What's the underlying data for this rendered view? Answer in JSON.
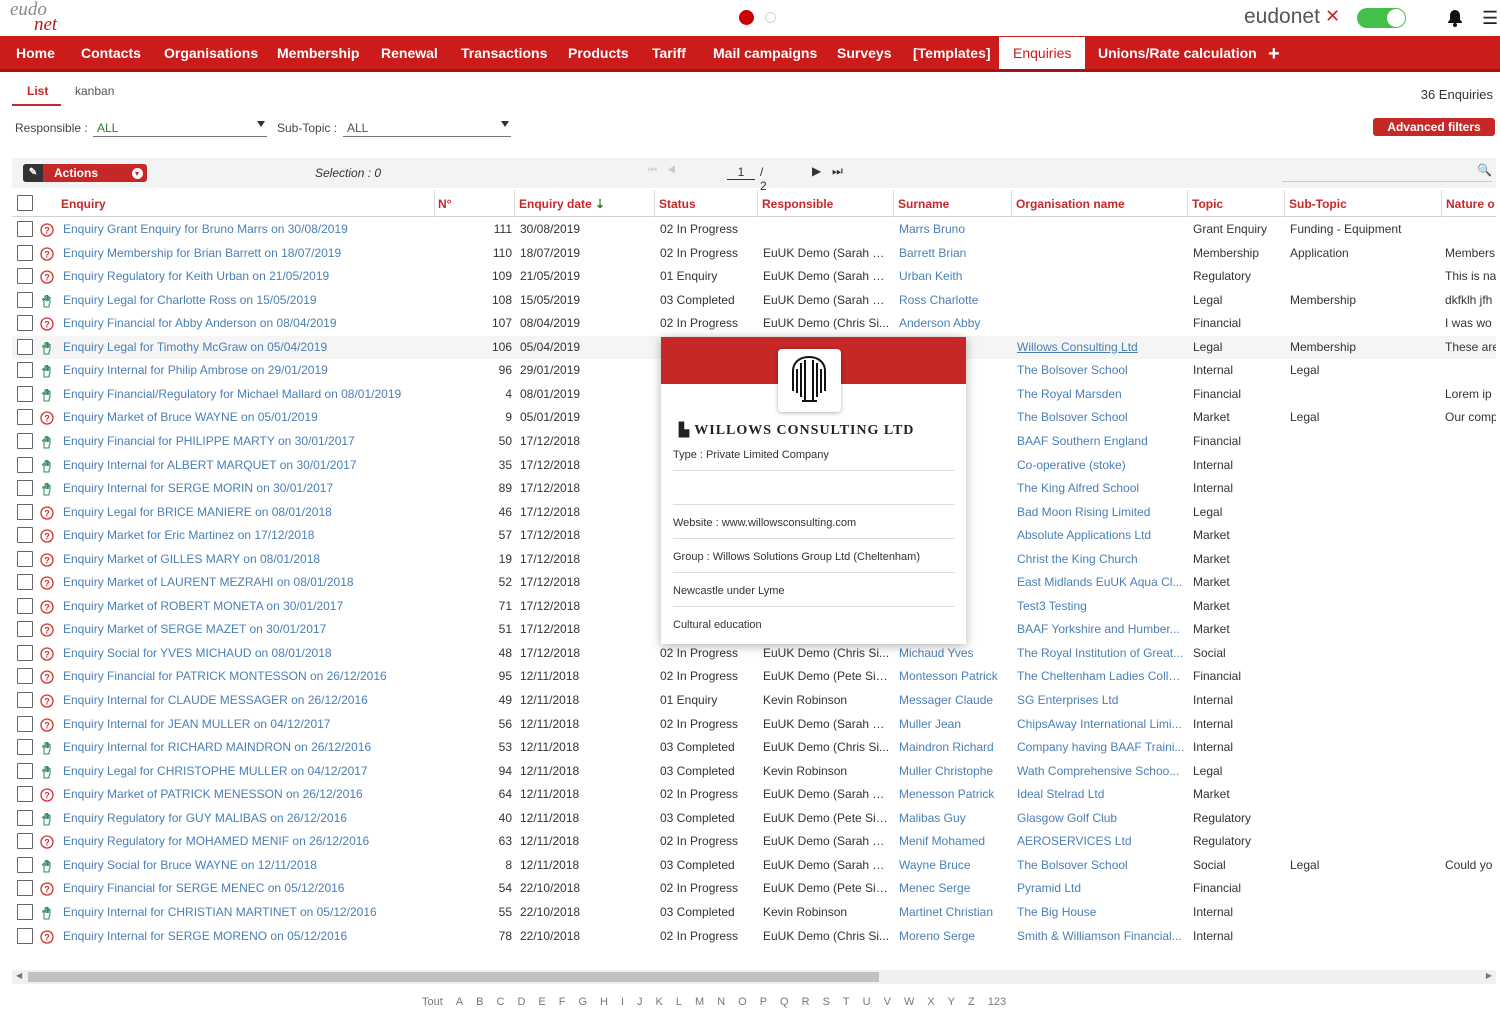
{
  "app": {
    "logo_top": "eudo",
    "logo_bottom": "net",
    "brand": "eudonet",
    "brand_mark": "✕"
  },
  "nav": [
    "Home",
    "Contacts",
    "Organisations",
    "Membership",
    "Renewal",
    "Transactions",
    "Products",
    "Tariff",
    "Mail campaigns",
    "Surveys",
    "[Templates]",
    "Enquiries",
    "Unions/Rate calculation"
  ],
  "nav_active": "Enquiries",
  "nav_plus": "+",
  "tabs": {
    "list": "List",
    "kanban": "kanban"
  },
  "count": "36 Enquiries",
  "filters": {
    "responsible_label": "Responsible :",
    "responsible_value": "ALL",
    "subtopic_label": "Sub-Topic :",
    "subtopic_value": "ALL",
    "advanced": "Advanced filters"
  },
  "toolbar": {
    "actions": "Actions",
    "selection": "Selection : 0",
    "page": "1",
    "pages": "/ 2"
  },
  "columns": [
    "Enquiry",
    "N°",
    "Enquiry date",
    "Status",
    "Responsible",
    "Surname",
    "Organisation name",
    "Topic",
    "Sub-Topic",
    "Nature o"
  ],
  "rows": [
    {
      "icon": "question",
      "enquiry": "Enquiry Grant Enquiry for Bruno Marrs on 30/08/2019",
      "n": "111",
      "date": "30/08/2019",
      "status": "02 In Progress",
      "resp": "",
      "surname": "Marrs Bruno",
      "org": "",
      "topic": "Grant Enquiry",
      "sub": "Funding - Equipment",
      "nature": ""
    },
    {
      "icon": "question",
      "enquiry": "Enquiry Membership for Brian Barrett on 18/07/2019",
      "n": "110",
      "date": "18/07/2019",
      "status": "02 In Progress",
      "resp": "EuUK Demo (Sarah C...",
      "surname": "Barrett Brian",
      "org": "",
      "topic": "Membership",
      "sub": "Application",
      "nature": "Members"
    },
    {
      "icon": "question",
      "enquiry": "Enquiry Regulatory for Keith Urban on 21/05/2019",
      "n": "109",
      "date": "21/05/2019",
      "status": "01 Enquiry",
      "resp": "EuUK Demo (Sarah C...",
      "surname": "Urban Keith",
      "org": "",
      "topic": "Regulatory",
      "sub": "",
      "nature": "This is na"
    },
    {
      "icon": "hand",
      "enquiry": "Enquiry Legal for Charlotte Ross on 15/05/2019",
      "n": "108",
      "date": "15/05/2019",
      "status": "03 Completed",
      "resp": "EuUK Demo (Sarah C...",
      "surname": "Ross Charlotte",
      "org": "",
      "topic": "Legal",
      "sub": "Membership",
      "nature": "dkfklh jfh"
    },
    {
      "icon": "question",
      "enquiry": "Enquiry Financial for Abby Anderson on 08/04/2019",
      "n": "107",
      "date": "08/04/2019",
      "status": "02 In Progress",
      "resp": "EuUK Demo (Chris Si...",
      "surname": "Anderson Abby",
      "org": "",
      "topic": "Financial",
      "sub": "",
      "nature": "I was wo"
    },
    {
      "icon": "hand",
      "enquiry": "Enquiry Legal for Timothy McGraw on 05/04/2019",
      "n": "106",
      "date": "05/04/2019",
      "status": "",
      "resp": "",
      "surname": "othy",
      "org": "Willows Consulting Ltd",
      "topic": "Legal",
      "sub": "Membership",
      "nature": "These are"
    },
    {
      "icon": "hand",
      "enquiry": "Enquiry Internal for Philip Ambrose on 29/01/2019",
      "n": "96",
      "date": "29/01/2019",
      "status": "",
      "resp": "",
      "surname": "ilip",
      "org": "The Bolsover School",
      "topic": "Internal",
      "sub": "Legal",
      "nature": ""
    },
    {
      "icon": "hand",
      "enquiry": "Enquiry Financial/Regulatory for Michael Mallard on 08/01/2019",
      "n": "4",
      "date": "08/01/2019",
      "status": "",
      "resp": "",
      "surname": "hael",
      "org": "The Royal Marsden",
      "topic": "Financial",
      "sub": "",
      "nature": "Lorem ip"
    },
    {
      "icon": "question",
      "enquiry": "Enquiry Market of Bruce WAYNE on 05/01/2019",
      "n": "9",
      "date": "05/01/2019",
      "status": "",
      "resp": "",
      "surname": "e",
      "org": "The Bolsover School",
      "topic": "Market",
      "sub": "Legal",
      "nature": "Our comp"
    },
    {
      "icon": "hand",
      "enquiry": "Enquiry Financial for PHILIPPE MARTY on 30/01/2017",
      "n": "50",
      "date": "17/12/2018",
      "status": "",
      "resp": "",
      "surname": "pe",
      "org": "BAAF Southern England",
      "topic": "Financial",
      "sub": "",
      "nature": ""
    },
    {
      "icon": "hand",
      "enquiry": "Enquiry Internal for ALBERT MARQUET on 30/01/2017",
      "n": "35",
      "date": "17/12/2018",
      "status": "",
      "resp": "",
      "surname": "ert",
      "org": "Co-operative (stoke)",
      "topic": "Internal",
      "sub": "",
      "nature": ""
    },
    {
      "icon": "hand",
      "enquiry": "Enquiry Internal for SERGE MORIN on 30/01/2017",
      "n": "89",
      "date": "17/12/2018",
      "status": "",
      "resp": "",
      "surname": "",
      "org": "The King Alfred School",
      "topic": "Internal",
      "sub": "",
      "nature": ""
    },
    {
      "icon": "question",
      "enquiry": "Enquiry Legal for BRICE MANIERE on 08/01/2018",
      "n": "46",
      "date": "17/12/2018",
      "status": "",
      "resp": "",
      "surname": "e",
      "org": "Bad Moon Rising Limited",
      "topic": "Legal",
      "sub": "",
      "nature": ""
    },
    {
      "icon": "question",
      "enquiry": "Enquiry Market for Eric Martinez on 17/12/2018",
      "n": "57",
      "date": "17/12/2018",
      "status": "",
      "resp": "",
      "surname": "c",
      "org": "Absolute Applications Ltd",
      "topic": "Market",
      "sub": "",
      "nature": ""
    },
    {
      "icon": "question",
      "enquiry": "Enquiry Market of GILLES MARY on 08/01/2018",
      "n": "19",
      "date": "17/12/2018",
      "status": "",
      "resp": "",
      "surname": "",
      "org": "Christ the King Church",
      "topic": "Market",
      "sub": "",
      "nature": ""
    },
    {
      "icon": "question",
      "enquiry": "Enquiry Market of LAURENT MEZRAHI on 08/01/2018",
      "n": "52",
      "date": "17/12/2018",
      "status": "",
      "resp": "",
      "surname": "rent",
      "org": "East Midlands EuUK Aqua Cl...",
      "topic": "Market",
      "sub": "",
      "nature": ""
    },
    {
      "icon": "question",
      "enquiry": "Enquiry Market of ROBERT MONETA on 30/01/2017",
      "n": "71",
      "date": "17/12/2018",
      "status": "",
      "resp": "",
      "surname": "ert",
      "org": "Test3 Testing",
      "topic": "Market",
      "sub": "",
      "nature": ""
    },
    {
      "icon": "question",
      "enquiry": "Enquiry Market of SERGE MAZET on 30/01/2017",
      "n": "51",
      "date": "17/12/2018",
      "status": "",
      "resp": "",
      "surname": "",
      "org": "BAAF Yorkshire and Humber...",
      "topic": "Market",
      "sub": "",
      "nature": ""
    },
    {
      "icon": "question",
      "enquiry": "Enquiry Social for YVES MICHAUD on 08/01/2018",
      "n": "48",
      "date": "17/12/2018",
      "status": "02 In Progress",
      "resp": "EuUK Demo (Chris Si...",
      "surname": "Michaud Yves",
      "org": "The Royal Institution of Great...",
      "topic": "Social",
      "sub": "",
      "nature": ""
    },
    {
      "icon": "question",
      "enquiry": "Enquiry Financial for PATRICK MONTESSON on 26/12/2016",
      "n": "95",
      "date": "12/11/2018",
      "status": "02 In Progress",
      "resp": "EuUK Demo (Pete Sin...",
      "surname": "Montesson Patrick",
      "org": "The Cheltenham Ladies Colle...",
      "topic": "Financial",
      "sub": "",
      "nature": ""
    },
    {
      "icon": "question",
      "enquiry": "Enquiry Internal for CLAUDE MESSAGER on 26/12/2016",
      "n": "49",
      "date": "12/11/2018",
      "status": "01 Enquiry",
      "resp": "Kevin Robinson",
      "surname": "Messager Claude",
      "org": "SG Enterprises Ltd",
      "topic": "Internal",
      "sub": "",
      "nature": ""
    },
    {
      "icon": "question",
      "enquiry": "Enquiry Internal for JEAN MULLER on 04/12/2017",
      "n": "56",
      "date": "12/11/2018",
      "status": "02 In Progress",
      "resp": "EuUK Demo (Sarah C...",
      "surname": "Muller Jean",
      "org": "ChipsAway International Limi...",
      "topic": "Internal",
      "sub": "",
      "nature": ""
    },
    {
      "icon": "hand",
      "enquiry": "Enquiry Internal for RICHARD MAINDRON on 26/12/2016",
      "n": "53",
      "date": "12/11/2018",
      "status": "03 Completed",
      "resp": "EuUK Demo (Chris Si...",
      "surname": "Maindron Richard",
      "org": "Company having BAAF Traini...",
      "topic": "Internal",
      "sub": "",
      "nature": ""
    },
    {
      "icon": "hand",
      "enquiry": "Enquiry Legal for CHRISTOPHE MULLER on 04/12/2017",
      "n": "94",
      "date": "12/11/2018",
      "status": "03 Completed",
      "resp": "Kevin Robinson",
      "surname": "Muller Christophe",
      "org": "Wath  Comprehensive Schoo...",
      "topic": "Legal",
      "sub": "",
      "nature": ""
    },
    {
      "icon": "question",
      "enquiry": "Enquiry Market of PATRICK MENESSON on 26/12/2016",
      "n": "64",
      "date": "12/11/2018",
      "status": "02 In Progress",
      "resp": "EuUK Demo (Sarah C...",
      "surname": "Menesson Patrick",
      "org": "Ideal Stelrad Ltd",
      "topic": "Market",
      "sub": "",
      "nature": ""
    },
    {
      "icon": "hand",
      "enquiry": "Enquiry Regulatory for GUY MALIBAS on 26/12/2016",
      "n": "40",
      "date": "12/11/2018",
      "status": "03 Completed",
      "resp": "EuUK Demo (Pete Sin...",
      "surname": "Malibas Guy",
      "org": "Glasgow Golf Club",
      "topic": "Regulatory",
      "sub": "",
      "nature": ""
    },
    {
      "icon": "question",
      "enquiry": "Enquiry Regulatory for MOHAMED MENIF on 26/12/2016",
      "n": "63",
      "date": "12/11/2018",
      "status": "02 In Progress",
      "resp": "EuUK Demo (Sarah C...",
      "surname": "Menif Mohamed",
      "org": "AEROSERVICES Ltd",
      "topic": "Regulatory",
      "sub": "",
      "nature": ""
    },
    {
      "icon": "hand",
      "enquiry": "Enquiry Social for Bruce WAYNE on 12/11/2018",
      "n": "8",
      "date": "12/11/2018",
      "status": "03 Completed",
      "resp": "EuUK Demo (Sarah C...",
      "surname": "Wayne Bruce",
      "org": "The Bolsover School",
      "topic": "Social",
      "sub": "Legal",
      "nature": "Could yo"
    },
    {
      "icon": "question",
      "enquiry": "Enquiry Financial for SERGE MENEC on 05/12/2016",
      "n": "54",
      "date": "22/10/2018",
      "status": "02 In Progress",
      "resp": "EuUK Demo (Pete Sin...",
      "surname": "Menec Serge",
      "org": "Pyramid Ltd",
      "topic": "Financial",
      "sub": "",
      "nature": ""
    },
    {
      "icon": "hand",
      "enquiry": "Enquiry Internal for CHRISTIAN MARTINET on 05/12/2016",
      "n": "55",
      "date": "22/10/2018",
      "status": "03 Completed",
      "resp": "Kevin Robinson",
      "surname": "Martinet Christian",
      "org": "The Big House",
      "topic": "Internal",
      "sub": "",
      "nature": ""
    },
    {
      "icon": "question",
      "enquiry": "Enquiry Internal for SERGE MORENO on 05/12/2016",
      "n": "78",
      "date": "22/10/2018",
      "status": "02 In Progress",
      "resp": "EuUK Demo (Chris Si...",
      "surname": "Moreno Serge",
      "org": "Smith & Williamson Financial...",
      "topic": "Internal",
      "sub": "",
      "nature": ""
    }
  ],
  "popup": {
    "name": "WILLOWS CONSULTING LTD",
    "type": "Type : Private Limited Company",
    "website": "Website : www.willowsconsulting.com",
    "group": "Group : Willows Solutions Group Ltd (Cheltenham)",
    "city": "Newcastle under Lyme",
    "sector": "Cultural education"
  },
  "alphabet": [
    "Tout",
    "A",
    "B",
    "C",
    "D",
    "E",
    "F",
    "G",
    "H",
    "I",
    "J",
    "K",
    "L",
    "M",
    "N",
    "O",
    "P",
    "Q",
    "R",
    "S",
    "T",
    "U",
    "V",
    "W",
    "X",
    "Y",
    "Z",
    "123"
  ],
  "colors": {
    "accent": "#cb1b1b",
    "link": "#4a7fb5",
    "toggle": "#43c04a"
  }
}
